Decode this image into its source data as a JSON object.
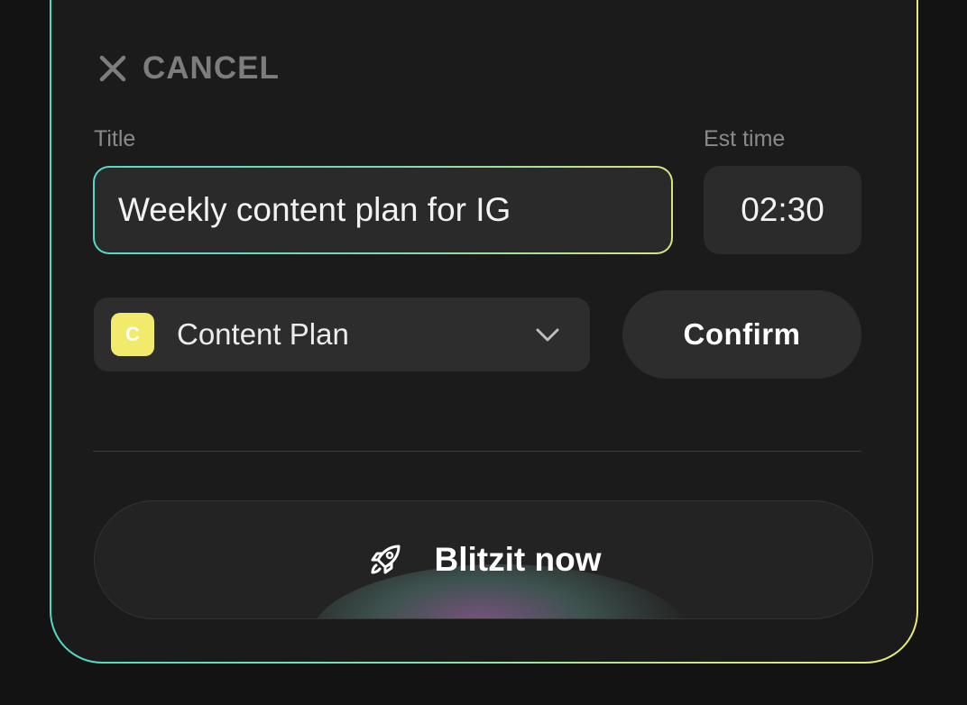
{
  "header": {
    "cancel_label": "CANCEL",
    "cancel_icon": "close-icon"
  },
  "form": {
    "title_label": "Title",
    "title_value": "Weekly content plan for IG",
    "time_label": "Est time",
    "time_value": "02:30",
    "category": {
      "badge_letter": "C",
      "badge_color": "#f1ea6a",
      "label": "Content Plan",
      "icon": "chevron-down-icon"
    },
    "confirm_label": "Confirm"
  },
  "action": {
    "label": "Blitzit now",
    "icon": "rocket-icon"
  },
  "colors": {
    "accent_gradient_start": "#4fd9c4",
    "accent_gradient_end": "#e7ea78",
    "surface": "#1b1b1b",
    "control": "#2d2d2d"
  }
}
